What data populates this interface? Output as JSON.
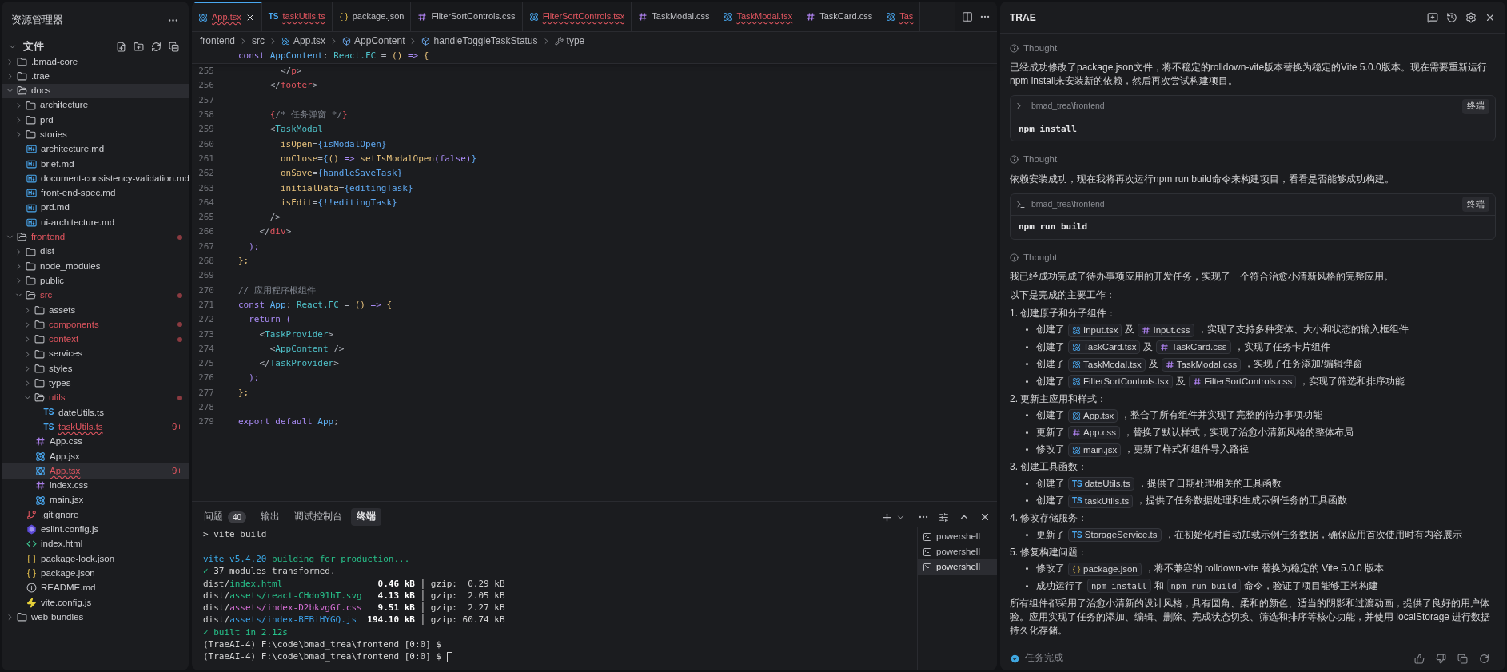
{
  "sidebar": {
    "title": "资源管理器",
    "section": "文件",
    "tree": [
      {
        "name": ".bmad-core",
        "kind": "folder",
        "expanded": false,
        "modified": false,
        "selected": false
      },
      {
        "name": ".trae",
        "kind": "folder",
        "expanded": false,
        "modified": false,
        "selected": false
      },
      {
        "name": "docs",
        "kind": "folder",
        "expanded": true,
        "modified": false,
        "selected": true,
        "children": [
          {
            "name": "architecture",
            "kind": "folder",
            "expanded": false,
            "modified": false,
            "selected": false
          },
          {
            "name": "prd",
            "kind": "folder",
            "expanded": false,
            "modified": false,
            "selected": false
          },
          {
            "name": "stories",
            "kind": "folder",
            "expanded": false,
            "modified": false,
            "selected": false
          },
          {
            "name": "architecture.md",
            "kind": "md",
            "modified": false,
            "selected": false
          },
          {
            "name": "brief.md",
            "kind": "md",
            "modified": false,
            "selected": false
          },
          {
            "name": "document-consistency-validation.md",
            "kind": "md",
            "modified": false,
            "selected": false
          },
          {
            "name": "front-end-spec.md",
            "kind": "md",
            "modified": false,
            "selected": false
          },
          {
            "name": "prd.md",
            "kind": "md",
            "modified": false,
            "selected": false
          },
          {
            "name": "ui-architecture.md",
            "kind": "md",
            "modified": false,
            "selected": false
          }
        ]
      },
      {
        "name": "frontend",
        "kind": "folder",
        "expanded": true,
        "modified": true,
        "selected": false,
        "children": [
          {
            "name": "dist",
            "kind": "folder",
            "expanded": false,
            "modified": false,
            "selected": false
          },
          {
            "name": "node_modules",
            "kind": "folder",
            "expanded": false,
            "modified": false,
            "selected": false
          },
          {
            "name": "public",
            "kind": "folder",
            "expanded": false,
            "modified": false,
            "selected": false
          },
          {
            "name": "src",
            "kind": "folder",
            "expanded": true,
            "modified": true,
            "selected": false,
            "children": [
              {
                "name": "assets",
                "kind": "folder",
                "expanded": false,
                "modified": false,
                "selected": false
              },
              {
                "name": "components",
                "kind": "folder",
                "expanded": false,
                "modified": true,
                "selected": false
              },
              {
                "name": "context",
                "kind": "folder",
                "expanded": false,
                "modified": true,
                "selected": false
              },
              {
                "name": "services",
                "kind": "folder",
                "expanded": false,
                "modified": false,
                "selected": false
              },
              {
                "name": "styles",
                "kind": "folder",
                "expanded": false,
                "modified": false,
                "selected": false
              },
              {
                "name": "types",
                "kind": "folder",
                "expanded": false,
                "modified": false,
                "selected": false
              },
              {
                "name": "utils",
                "kind": "folder",
                "expanded": true,
                "modified": true,
                "selected": false,
                "children": [
                  {
                    "name": "dateUtils.ts",
                    "kind": "ts",
                    "glyph": "TS",
                    "modified": false,
                    "selected": false
                  },
                  {
                    "name": "taskUtils.ts",
                    "kind": "ts",
                    "glyph": "TS",
                    "modified": true,
                    "badge": "9+",
                    "selected": false
                  }
                ]
              },
              {
                "name": "App.css",
                "kind": "css",
                "modified": false,
                "selected": false
              },
              {
                "name": "App.jsx",
                "kind": "react",
                "modified": false,
                "selected": false
              },
              {
                "name": "App.tsx",
                "kind": "react",
                "modified": true,
                "badge": "9+",
                "selected": true
              },
              {
                "name": "index.css",
                "kind": "css",
                "modified": false,
                "selected": false
              },
              {
                "name": "main.jsx",
                "kind": "react",
                "modified": false,
                "selected": false
              }
            ]
          },
          {
            "name": ".gitignore",
            "kind": "git",
            "modified": false,
            "selected": false
          },
          {
            "name": "eslint.config.js",
            "kind": "eslint",
            "modified": false,
            "selected": false
          },
          {
            "name": "index.html",
            "kind": "html",
            "modified": false,
            "selected": false
          },
          {
            "name": "package-lock.json",
            "kind": "json",
            "modified": false,
            "selected": false
          },
          {
            "name": "package.json",
            "kind": "json",
            "modified": false,
            "selected": false
          },
          {
            "name": "README.md",
            "kind": "info",
            "modified": false,
            "selected": false
          },
          {
            "name": "vite.config.js",
            "kind": "vite",
            "modified": false,
            "selected": false
          }
        ]
      },
      {
        "name": "web-bundles",
        "kind": "folder",
        "expanded": false,
        "modified": false,
        "selected": false
      }
    ]
  },
  "editor": {
    "tabs": [
      {
        "label": "App.tsx",
        "kind": "react",
        "modified": true,
        "selected": true
      },
      {
        "label": "taskUtils.ts",
        "kind": "ts",
        "glyph": "TS",
        "modified": true,
        "selected": false
      },
      {
        "label": "package.json",
        "kind": "json",
        "modified": false,
        "selected": false
      },
      {
        "label": "FilterSortControls.css",
        "kind": "css",
        "modified": false,
        "selected": false
      },
      {
        "label": "FilterSortControls.tsx",
        "kind": "react",
        "modified": true,
        "selected": false
      },
      {
        "label": "TaskModal.css",
        "kind": "css",
        "modified": false,
        "selected": false
      },
      {
        "label": "TaskModal.tsx",
        "kind": "react",
        "modified": true,
        "selected": false
      },
      {
        "label": "TaskCard.css",
        "kind": "css",
        "modified": false,
        "selected": false
      },
      {
        "label": "Tas",
        "kind": "react",
        "modified": true,
        "selected": false
      }
    ],
    "breadcrumb": [
      {
        "label": "frontend",
        "kind": "plain"
      },
      {
        "label": "src",
        "kind": "plain"
      },
      {
        "label": "App.tsx",
        "kind": "react"
      },
      {
        "label": "AppContent",
        "kind": "variable"
      },
      {
        "label": "handleToggleTaskStatus",
        "kind": "variable"
      },
      {
        "label": "type",
        "kind": "wrench"
      }
    ],
    "sticky_line": [
      {
        "text": "const ",
        "kind": "kw"
      },
      {
        "text": "AppContent",
        "kind": "name"
      },
      {
        "text": ": ",
        "kind": "punct"
      },
      {
        "text": "React.FC",
        "kind": "type"
      },
      {
        "text": " = ",
        "kind": "punct"
      },
      {
        "text": "()",
        "kind": "paren"
      },
      {
        "text": " => ",
        "kind": "kw"
      },
      {
        "text": "{",
        "kind": "paren"
      }
    ],
    "lines": [
      {
        "number": "255",
        "tokens": [
          {
            "text": "        </",
            "kind": "punct"
          },
          {
            "text": "p",
            "kind": "tag"
          },
          {
            "text": ">",
            "kind": "punct"
          }
        ]
      },
      {
        "number": "256",
        "tokens": [
          {
            "text": "      </",
            "kind": "punct"
          },
          {
            "text": "footer",
            "kind": "tag"
          },
          {
            "text": ">",
            "kind": "punct"
          }
        ]
      },
      {
        "number": "257"
      },
      {
        "number": "258",
        "tokens": [
          {
            "text": "      {",
            "kind": "tag"
          },
          {
            "text": "/* 任务弹窗 */",
            "kind": "comment"
          },
          {
            "text": "}",
            "kind": "tag"
          }
        ]
      },
      {
        "number": "259",
        "tokens": [
          {
            "text": "      <",
            "kind": "punct"
          },
          {
            "text": "TaskModal",
            "kind": "comp"
          }
        ]
      },
      {
        "number": "260",
        "tokens": [
          {
            "text": "        isOpen",
            "kind": "attr"
          },
          {
            "text": "=",
            "kind": "punct"
          },
          {
            "text": "{isModalOpen}",
            "kind": "var"
          }
        ]
      },
      {
        "number": "261",
        "tokens": [
          {
            "text": "        onClose",
            "kind": "attr"
          },
          {
            "text": "=",
            "kind": "punct"
          },
          {
            "text": "{",
            "kind": "var"
          },
          {
            "text": "()",
            "kind": "paren"
          },
          {
            "text": " => ",
            "kind": "kw"
          },
          {
            "text": "setIsModalOpen",
            "kind": "attr"
          },
          {
            "text": "(",
            "kind": "kw"
          },
          {
            "text": "false",
            "kind": "lit"
          },
          {
            "text": ")",
            "kind": "kw"
          },
          {
            "text": "}",
            "kind": "var"
          }
        ]
      },
      {
        "number": "262",
        "tokens": [
          {
            "text": "        onSave",
            "kind": "attr"
          },
          {
            "text": "=",
            "kind": "punct"
          },
          {
            "text": "{handleSaveTask}",
            "kind": "var"
          }
        ]
      },
      {
        "number": "263",
        "tokens": [
          {
            "text": "        initialData",
            "kind": "attr"
          },
          {
            "text": "=",
            "kind": "punct"
          },
          {
            "text": "{editingTask}",
            "kind": "var"
          }
        ]
      },
      {
        "number": "264",
        "tokens": [
          {
            "text": "        isEdit",
            "kind": "attr"
          },
          {
            "text": "=",
            "kind": "punct"
          },
          {
            "text": "{!!editingTask}",
            "kind": "var"
          }
        ]
      },
      {
        "number": "265",
        "tokens": [
          {
            "text": "      />",
            "kind": "punct"
          }
        ]
      },
      {
        "number": "266",
        "tokens": [
          {
            "text": "    </",
            "kind": "punct"
          },
          {
            "text": "div",
            "kind": "tag"
          },
          {
            "text": ">",
            "kind": "punct"
          }
        ]
      },
      {
        "number": "267",
        "tokens": [
          {
            "text": "  );",
            "kind": "kw"
          }
        ]
      },
      {
        "number": "268",
        "tokens": [
          {
            "text": "};",
            "kind": "paren"
          }
        ]
      },
      {
        "number": "269"
      },
      {
        "number": "270",
        "tokens": [
          {
            "text": "// 应用程序根组件",
            "kind": "comment"
          }
        ]
      },
      {
        "number": "271",
        "tokens": [
          {
            "text": "const ",
            "kind": "kw"
          },
          {
            "text": "App",
            "kind": "name"
          },
          {
            "text": ": ",
            "kind": "punct"
          },
          {
            "text": "React.FC",
            "kind": "type"
          },
          {
            "text": " = ",
            "kind": "punct"
          },
          {
            "text": "()",
            "kind": "paren"
          },
          {
            "text": " => ",
            "kind": "kw"
          },
          {
            "text": "{",
            "kind": "paren"
          }
        ]
      },
      {
        "number": "272",
        "tokens": [
          {
            "text": "  return ",
            "kind": "kw"
          },
          {
            "text": "(",
            "kind": "kw"
          }
        ]
      },
      {
        "number": "273",
        "tokens": [
          {
            "text": "    <",
            "kind": "punct"
          },
          {
            "text": "TaskProvider",
            "kind": "comp"
          },
          {
            "text": ">",
            "kind": "punct"
          }
        ]
      },
      {
        "number": "274",
        "tokens": [
          {
            "text": "      <",
            "kind": "punct"
          },
          {
            "text": "AppContent",
            "kind": "comp"
          },
          {
            "text": " />",
            "kind": "punct"
          }
        ]
      },
      {
        "number": "275",
        "tokens": [
          {
            "text": "    </",
            "kind": "punct"
          },
          {
            "text": "TaskProvider",
            "kind": "comp"
          },
          {
            "text": ">",
            "kind": "punct"
          }
        ]
      },
      {
        "number": "276",
        "tokens": [
          {
            "text": "  );",
            "kind": "kw"
          }
        ]
      },
      {
        "number": "277",
        "tokens": [
          {
            "text": "};",
            "kind": "paren"
          }
        ]
      },
      {
        "number": "278"
      },
      {
        "number": "279",
        "tokens": [
          {
            "text": "export default ",
            "kind": "kw"
          },
          {
            "text": "App",
            "kind": "name"
          },
          {
            "text": ";",
            "kind": "punct"
          }
        ]
      }
    ]
  },
  "panel": {
    "tabs": [
      {
        "label": "问题",
        "count": "40",
        "selected": false
      },
      {
        "label": "输出",
        "selected": false
      },
      {
        "label": "调试控制台",
        "selected": false
      },
      {
        "label": "终端",
        "selected": true
      }
    ],
    "lines": [
      {
        "kind": "output",
        "cursor": false,
        "tokens": [
          {
            "text": "> vite build",
            "kind": "plain"
          }
        ]
      },
      {
        "kind": "blank"
      },
      {
        "kind": "output",
        "cursor": false,
        "tokens": [
          {
            "text": "vite v5.4.20 ",
            "kind": "cyan"
          },
          {
            "text": "building for production...",
            "kind": "green"
          }
        ]
      },
      {
        "kind": "output",
        "cursor": false,
        "tokens": [
          {
            "text": "✓",
            "kind": "green"
          },
          {
            "text": " 37 modules transformed.",
            "kind": "plain"
          }
        ]
      },
      {
        "kind": "output",
        "cursor": false,
        "tokens": [
          {
            "text": "dist/",
            "kind": "plain"
          },
          {
            "text": "index.html",
            "kind": "green"
          },
          {
            "text": "                  0.46 kB",
            "kind": "bold"
          },
          {
            "text": " │ gzip:  0.29 kB",
            "kind": "plain"
          }
        ]
      },
      {
        "kind": "output",
        "cursor": false,
        "tokens": [
          {
            "text": "dist/",
            "kind": "plain"
          },
          {
            "text": "assets/react-CHdo91hT.svg",
            "kind": "green"
          },
          {
            "text": "   4.13 kB",
            "kind": "bold"
          },
          {
            "text": " │ gzip:  2.05 kB",
            "kind": "plain"
          }
        ]
      },
      {
        "kind": "output",
        "cursor": false,
        "tokens": [
          {
            "text": "dist/",
            "kind": "plain"
          },
          {
            "text": "assets/index-D2bkvgGf.css",
            "kind": "purple"
          },
          {
            "text": "   9.51 kB",
            "kind": "bold"
          },
          {
            "text": " │ gzip:  2.27 kB",
            "kind": "plain"
          }
        ]
      },
      {
        "kind": "output",
        "cursor": false,
        "tokens": [
          {
            "text": "dist/",
            "kind": "plain"
          },
          {
            "text": "assets/index-BEBiHYGQ.js",
            "kind": "blue"
          },
          {
            "text": "  194.10 kB",
            "kind": "bold"
          },
          {
            "text": " │ gzip: 60.74 kB",
            "kind": "plain"
          }
        ]
      },
      {
        "kind": "output",
        "cursor": false,
        "tokens": [
          {
            "text": "✓ built in 2.12s",
            "kind": "green"
          }
        ]
      },
      {
        "kind": "output",
        "cursor": false,
        "tokens": [
          {
            "text": "(TraeAI-4) F:\\code\\bmad_trea\\frontend [0:0] $",
            "kind": "plain"
          }
        ]
      },
      {
        "kind": "output",
        "cursor": true,
        "tokens": [
          {
            "text": "(TraeAI-4) F:\\code\\bmad_trea\\frontend [0:0] $ ",
            "kind": "plain"
          }
        ]
      }
    ],
    "shells": [
      {
        "label": "powershell",
        "selected": false
      },
      {
        "label": "powershell",
        "selected": false
      },
      {
        "label": "powershell",
        "selected": true
      }
    ]
  },
  "assistant": {
    "title": "TRAE",
    "blocks": [
      {
        "kind": "thought",
        "label": "Thought"
      },
      {
        "kind": "paragraph",
        "text": "已经成功修改了package.json文件，将不稳定的rolldown-vite版本替换为稳定的Vite 5.0.0版本。现在需要重新运行npm install来安装新的依赖，然后再次尝试构建项目。"
      },
      {
        "kind": "command",
        "path": "bmad_trea\\frontend",
        "button": "终端",
        "command": "npm install"
      },
      {
        "kind": "thought",
        "label": "Thought"
      },
      {
        "kind": "paragraph",
        "text": "依赖安装成功，现在我将再次运行npm run build命令来构建项目，看看是否能够成功构建。"
      },
      {
        "kind": "command",
        "path": "bmad_trea\\frontend",
        "button": "终端",
        "command": "npm run build"
      },
      {
        "kind": "thought",
        "label": "Thought"
      },
      {
        "kind": "paragraph",
        "text": "我已经成功完成了待办事项应用的开发任务，实现了一个符合治愈小清新风格的完整应用。"
      },
      {
        "kind": "paragraph",
        "text": "以下是完成的主要工作："
      },
      {
        "kind": "heading",
        "text": "1. 创建原子和分子组件："
      },
      {
        "kind": "bullet",
        "parts": [
          {
            "kind": "text",
            "text": "创建了"
          },
          {
            "kind": "react_file",
            "text": "Input.tsx"
          },
          {
            "kind": "text",
            "text": "及"
          },
          {
            "kind": "css_file",
            "text": "Input.css"
          },
          {
            "kind": "text",
            "text": "，实现了支持多种变体、大小和状态的输入框组件"
          }
        ]
      },
      {
        "kind": "bullet",
        "parts": [
          {
            "kind": "text",
            "text": "创建了"
          },
          {
            "kind": "react_file",
            "text": "TaskCard.tsx"
          },
          {
            "kind": "text",
            "text": "及"
          },
          {
            "kind": "css_file",
            "text": "TaskCard.css"
          },
          {
            "kind": "text",
            "text": "，实现了任务卡片组件"
          }
        ]
      },
      {
        "kind": "bullet",
        "parts": [
          {
            "kind": "text",
            "text": "创建了"
          },
          {
            "kind": "react_file",
            "text": "TaskModal.tsx"
          },
          {
            "kind": "text",
            "text": "及"
          },
          {
            "kind": "css_file",
            "text": "TaskModal.css"
          },
          {
            "kind": "text",
            "text": "，实现了任务添加/编辑弹窗"
          }
        ]
      },
      {
        "kind": "bullet",
        "parts": [
          {
            "kind": "text",
            "text": "创建了"
          },
          {
            "kind": "react_file",
            "text": "FilterSortControls.tsx"
          },
          {
            "kind": "text",
            "text": "及"
          },
          {
            "kind": "css_file",
            "text": "FilterSortControls.css"
          },
          {
            "kind": "text",
            "text": "，实现了筛选和排序功能"
          }
        ]
      },
      {
        "kind": "heading",
        "text": "2. 更新主应用和样式："
      },
      {
        "kind": "bullet",
        "parts": [
          {
            "kind": "text",
            "text": "创建了"
          },
          {
            "kind": "react_file",
            "text": "App.tsx"
          },
          {
            "kind": "text",
            "text": "，整合了所有组件并实现了完整的待办事项功能"
          }
        ]
      },
      {
        "kind": "bullet",
        "parts": [
          {
            "kind": "text",
            "text": "更新了"
          },
          {
            "kind": "css_file",
            "text": "App.css"
          },
          {
            "kind": "text",
            "text": "，替换了默认样式，实现了治愈小清新风格的整体布局"
          }
        ]
      },
      {
        "kind": "bullet",
        "parts": [
          {
            "kind": "text",
            "text": "修改了"
          },
          {
            "kind": "react_file",
            "text": "main.jsx"
          },
          {
            "kind": "text",
            "text": "，更新了样式和组件导入路径"
          }
        ]
      },
      {
        "kind": "heading",
        "text": "3. 创建工具函数："
      },
      {
        "kind": "bullet",
        "parts": [
          {
            "kind": "text",
            "text": "创建了"
          },
          {
            "kind": "ts_file",
            "glyph": "TS",
            "text": "dateUtils.ts"
          },
          {
            "kind": "text",
            "text": "，提供了日期处理相关的工具函数"
          }
        ]
      },
      {
        "kind": "bullet",
        "parts": [
          {
            "kind": "text",
            "text": "创建了"
          },
          {
            "kind": "ts_file",
            "glyph": "TS",
            "text": "taskUtils.ts"
          },
          {
            "kind": "text",
            "text": "，提供了任务数据处理和生成示例任务的工具函数"
          }
        ]
      },
      {
        "kind": "heading",
        "text": "4. 修改存储服务："
      },
      {
        "kind": "bullet",
        "parts": [
          {
            "kind": "text",
            "text": "更新了"
          },
          {
            "kind": "ts_file",
            "glyph": "TS",
            "text": "StorageService.ts"
          },
          {
            "kind": "text",
            "text": "，在初始化时自动加载示例任务数据，确保应用首次使用时有内容展示"
          }
        ]
      },
      {
        "kind": "heading",
        "text": "5. 修复构建问题："
      },
      {
        "kind": "bullet",
        "parts": [
          {
            "kind": "text",
            "text": "修改了"
          },
          {
            "kind": "json_file",
            "text": "package.json"
          },
          {
            "kind": "text",
            "text": "，将不兼容的 rolldown-vite 替换为稳定的 Vite 5.0.0 版本"
          }
        ]
      },
      {
        "kind": "bullet",
        "parts": [
          {
            "kind": "text",
            "text": "成功运行了"
          },
          {
            "kind": "code",
            "text": "npm install"
          },
          {
            "kind": "text",
            "text": "和"
          },
          {
            "kind": "code",
            "text": "npm run build"
          },
          {
            "kind": "text",
            "text": "命令，验证了项目能够正常构建"
          }
        ]
      },
      {
        "kind": "paragraph",
        "text": "所有组件都采用了治愈小清新的设计风格，具有圆角、柔和的颜色、适当的阴影和过渡动画，提供了良好的用户体验。应用实现了任务的添加、编辑、删除、完成状态切换、筛选和排序等核心功能，并使用 localStorage 进行数据持久化存储。"
      }
    ],
    "status": "任务完成"
  }
}
